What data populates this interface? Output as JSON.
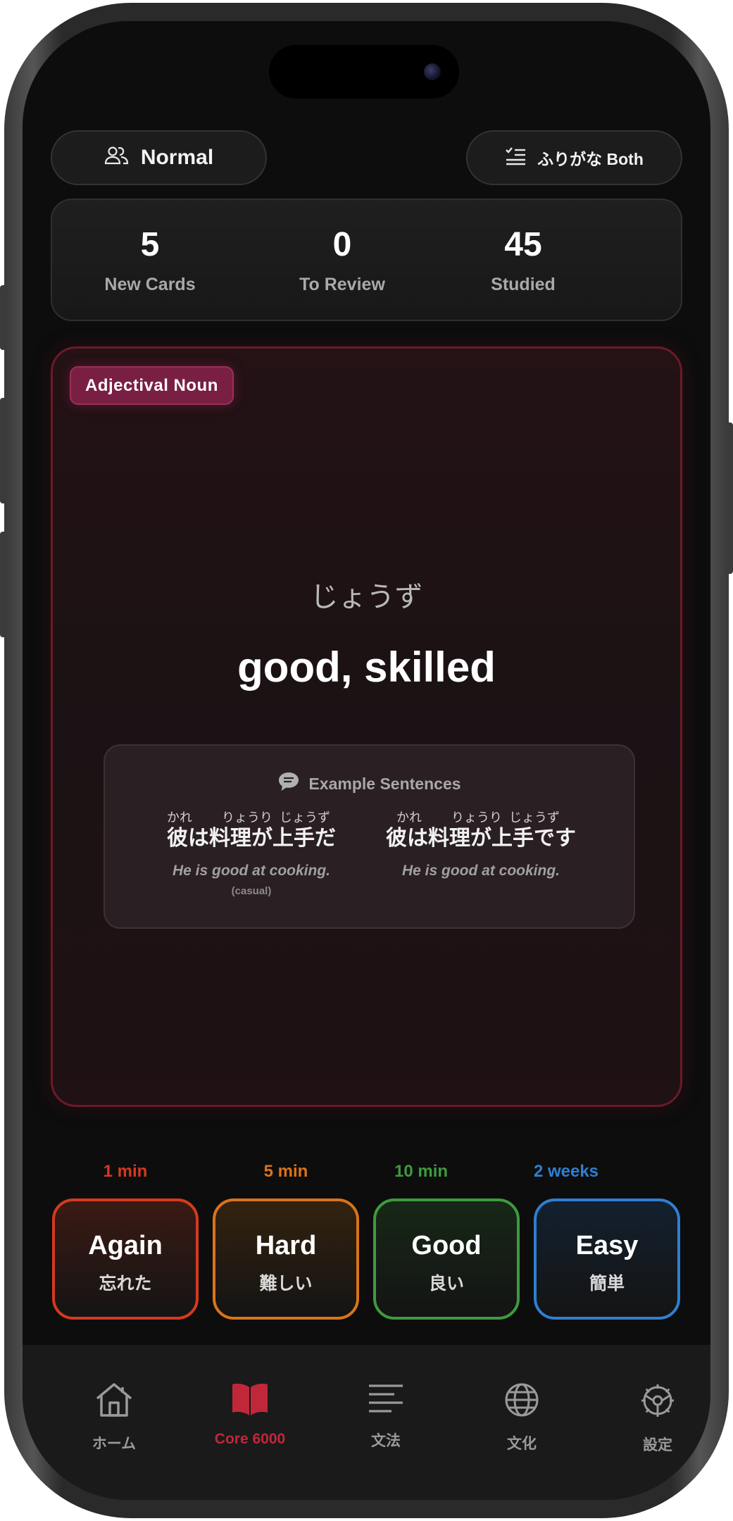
{
  "top": {
    "mode_label": "Normal",
    "furigana_label": "ふりがな Both"
  },
  "stats": [
    {
      "value": "5",
      "label": "New Cards"
    },
    {
      "value": "0",
      "label": "To Review"
    },
    {
      "value": "45",
      "label": "Studied"
    }
  ],
  "card": {
    "badge": "Adjectival Noun",
    "reading": "じょうず",
    "meaning": "good, skilled",
    "examples_title": "Example Sentences",
    "examples": [
      {
        "furigana": [
          "かれ",
          "りょうり",
          "じょうず"
        ],
        "japanese": "彼は料理が上手だ",
        "english": "He is good at cooking.",
        "note": "(casual)"
      },
      {
        "furigana": [
          "かれ",
          "りょうり",
          "じょうず"
        ],
        "japanese": "彼は料理が上手です",
        "english": "He is good at cooking."
      }
    ]
  },
  "answers": [
    {
      "interval": "1 min",
      "label": "Again",
      "jp": "忘れた",
      "color": "#d43a1e",
      "bg": "#3a1a14"
    },
    {
      "interval": "5 min",
      "label": "Hard",
      "jp": "難しい",
      "color": "#d9741a",
      "bg": "#33220f"
    },
    {
      "interval": "10 min",
      "label": "Good",
      "jp": "良い",
      "color": "#3e9a3e",
      "bg": "#172717"
    },
    {
      "interval": "2 weeks",
      "label": "Easy",
      "jp": "簡単",
      "color": "#2f7fd0",
      "bg": "#13202e"
    }
  ],
  "tabs": [
    {
      "label": "ホーム",
      "icon": "home-icon"
    },
    {
      "label": "Core 6000",
      "icon": "book-icon",
      "active": true
    },
    {
      "label": "文法",
      "icon": "text-lines-icon"
    },
    {
      "label": "文化",
      "icon": "globe-icon"
    },
    {
      "label": "設定",
      "icon": "gear-icon"
    }
  ]
}
